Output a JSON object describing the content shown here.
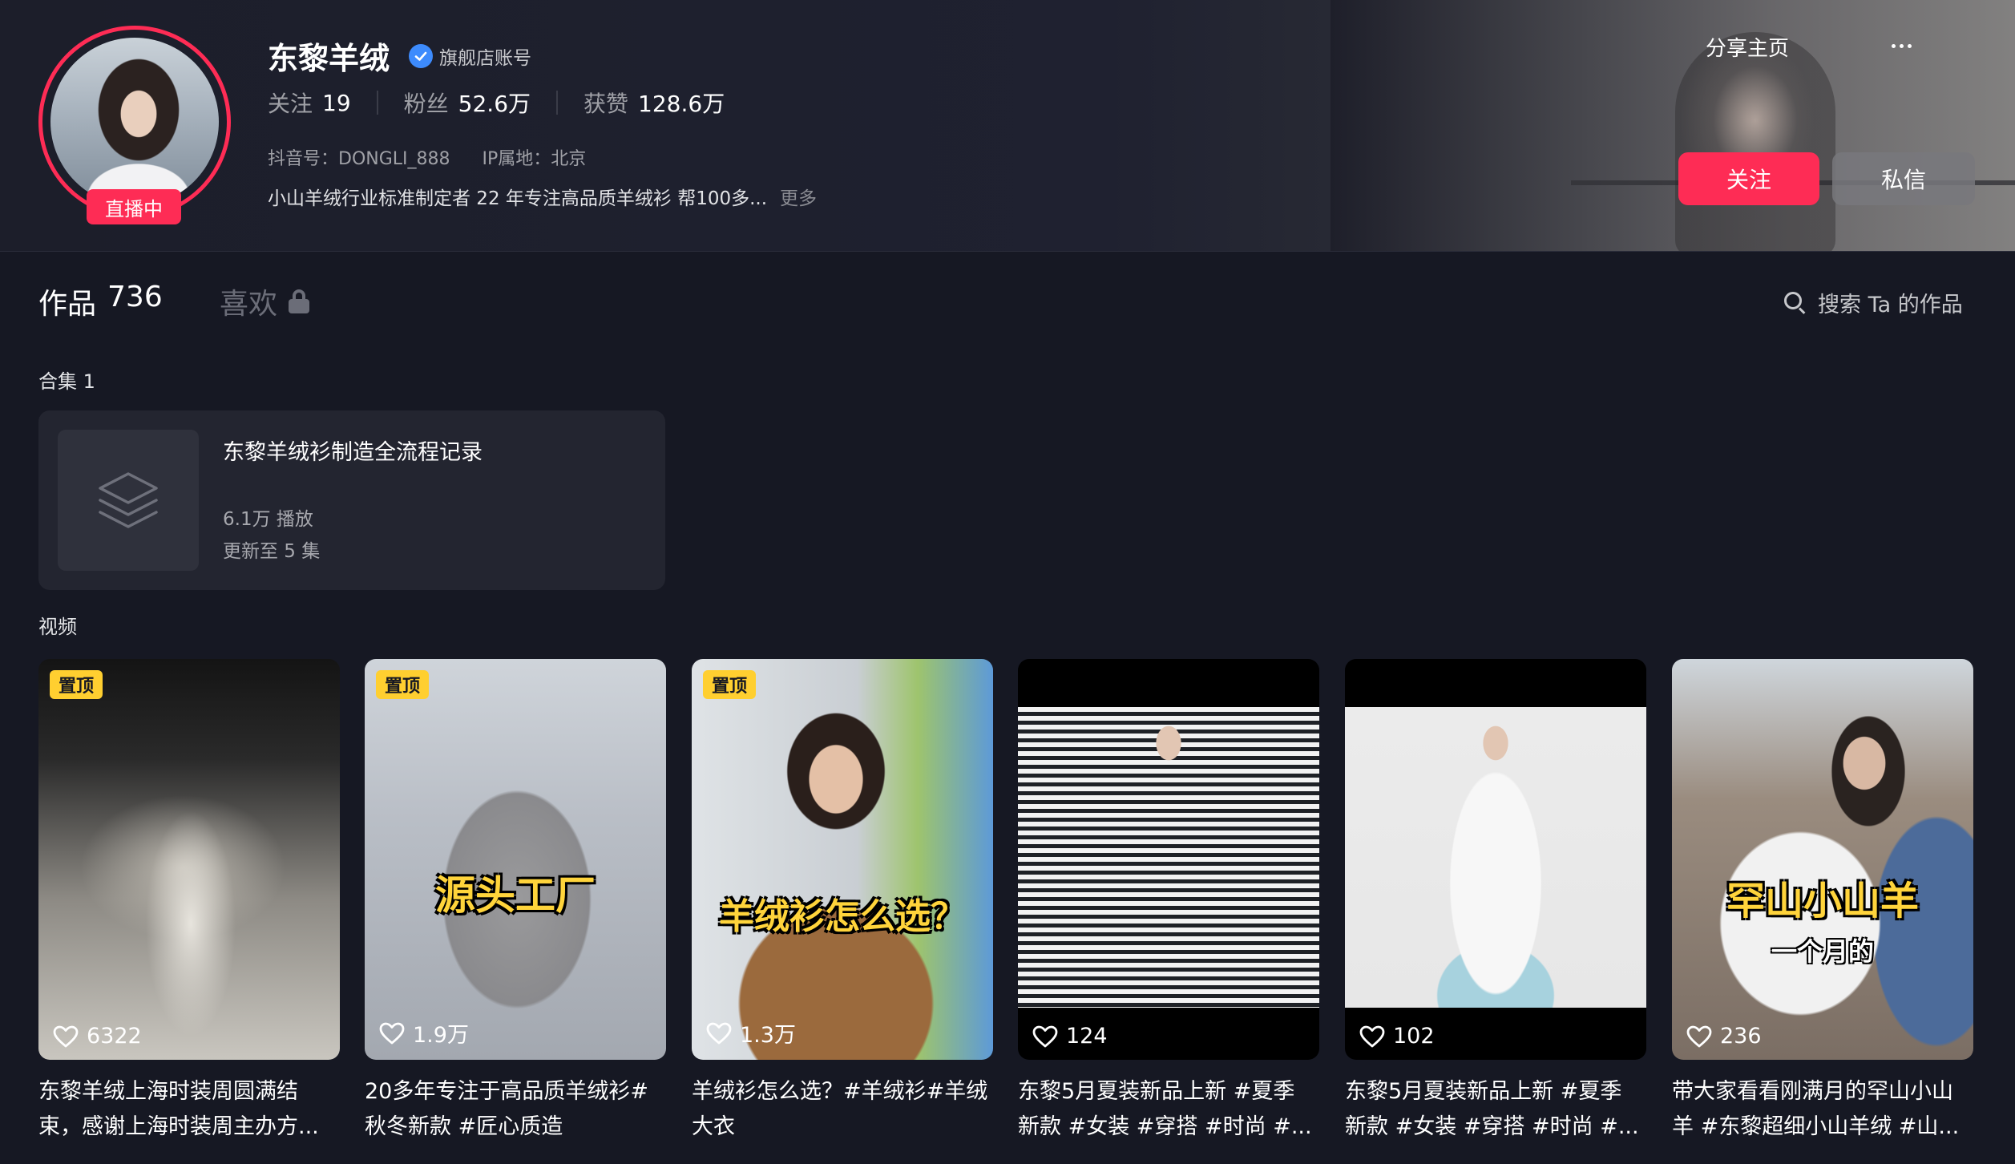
{
  "profile": {
    "name": "东黎羊绒",
    "verify_label": "旗舰店账号",
    "live_badge": "直播中",
    "following_label": "关注",
    "following_value": "19",
    "fans_label": "粉丝",
    "fans_value": "52.6万",
    "likes_label": "获赞",
    "likes_value": "128.6万",
    "douyin_id": "抖音号：DONGLI_888",
    "ip_location": "IP属地：北京",
    "bio": "小山羊绒行业标准制定者 22 年专注高品质羊绒衫 帮100多...",
    "bio_more": "更多"
  },
  "actions": {
    "share": "分享主页",
    "more_icon": "ellipsis-icon",
    "follow": "关注",
    "message": "私信",
    "accent_color": "#fe2c55"
  },
  "tabs": {
    "works_label": "作品",
    "works_count": "736",
    "likes_label": "喜欢",
    "search_placeholder": "搜索 Ta 的作品"
  },
  "collections": {
    "section_label": "合集 1",
    "items": [
      {
        "title": "东黎羊绒衫制造全流程记录",
        "plays": "6.1万 播放",
        "updated": "更新至 5 集"
      }
    ]
  },
  "videos": {
    "section_label": "视频",
    "pin_label": "置顶",
    "items": [
      {
        "likes": "6322",
        "caption_line1": "东黎羊绒上海时装周圆满结",
        "caption_line2": "束，感谢上海时装周主办方...",
        "overlay": ""
      },
      {
        "likes": "1.9万",
        "caption_line1": "20多年专注于高品质羊绒衫#",
        "caption_line2": "秋冬新款 #匠心质造",
        "overlay": "源头工厂"
      },
      {
        "likes": "1.3万",
        "caption_line1": "羊绒衫怎么选？#羊绒衫#羊绒",
        "caption_line2": "大衣",
        "overlay": "羊绒衫怎么选？"
      },
      {
        "likes": "124",
        "caption_line1": "东黎5月夏装新品上新 #夏季",
        "caption_line2": "新款 #女装 #穿搭 #时尚 #...",
        "overlay": ""
      },
      {
        "likes": "102",
        "caption_line1": "东黎5月夏装新品上新 #夏季",
        "caption_line2": "新款 #女装 #穿搭 #时尚 #...",
        "overlay": ""
      },
      {
        "likes": "236",
        "caption_line1": "带大家看看刚满月的罕山小山",
        "caption_line2": "羊 #东黎超细小山羊绒 #山...",
        "overlay": "罕山小山羊",
        "overlay_sub": "一个月的"
      }
    ]
  }
}
